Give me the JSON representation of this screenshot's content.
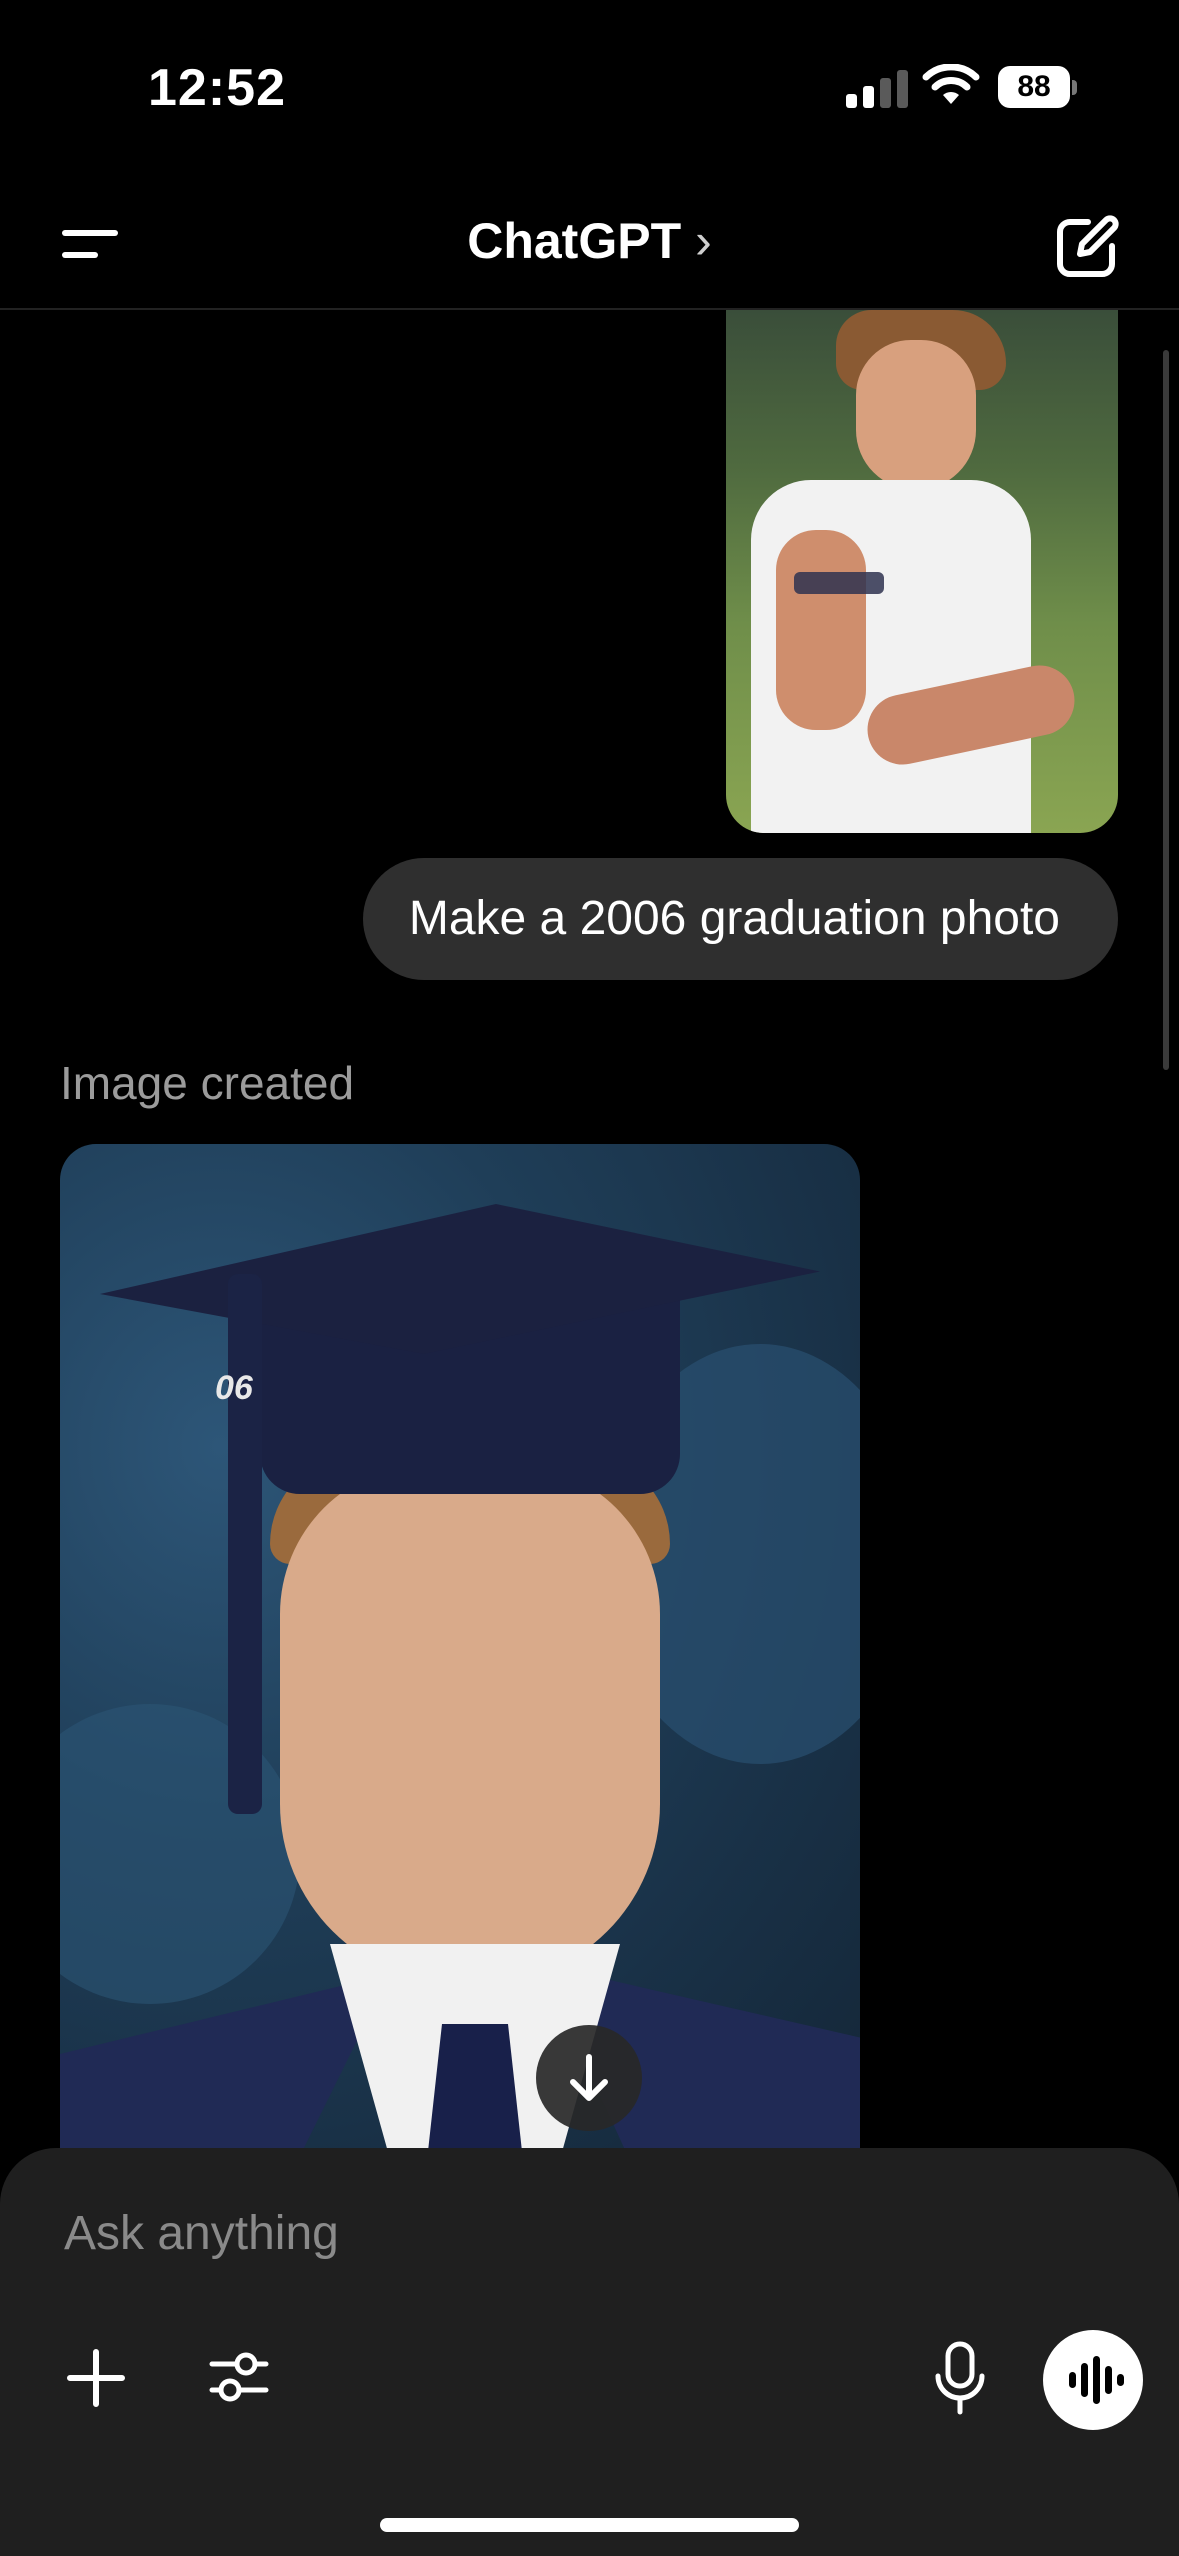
{
  "status_bar": {
    "time": "12:52",
    "battery": "88"
  },
  "header": {
    "title": "ChatGPT",
    "chevron": "›",
    "menu_icon": "menu-icon",
    "compose_icon": "compose-icon"
  },
  "chat": {
    "user_message": "Make a 2006 graduation photo",
    "assistant_label": "Image created",
    "image_tag": "06"
  },
  "composer": {
    "placeholder": "Ask anything",
    "plus_icon": "plus-icon",
    "tools_icon": "sliders-icon",
    "mic_icon": "microphone-icon",
    "voice_icon": "voice-wave-icon"
  }
}
